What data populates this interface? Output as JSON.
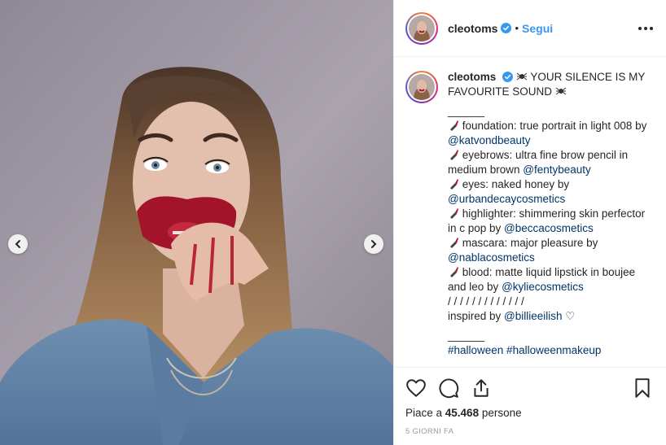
{
  "post": {
    "username": "cleotoms",
    "separator": "•",
    "follow_label": "Segui",
    "more_icon": "more-options-icon"
  },
  "caption": {
    "username": "cleotoms",
    "title": "YOUR SILENCE IS MY FAVOURITE SOUND",
    "divider1": "______",
    "items": [
      {
        "text": "foundation: true portrait in light 008 by ",
        "tag": "@katvondbeauty"
      },
      {
        "text": "eyebrows: ultra fine brow pencil in medium brown ",
        "tag": "@fentybeauty"
      },
      {
        "text": "eyes: naked honey by ",
        "tag": "@urbandecaycosmetics"
      },
      {
        "text": "highlighter: shimmering skin perfector in c pop by ",
        "tag": "@beccacosmetics"
      },
      {
        "text": "mascara: major pleasure by ",
        "tag": "@nablacosmetics"
      },
      {
        "text": "blood: matte liquid lipstick in boujee and leo by ",
        "tag": "@kyliecosmetics"
      }
    ],
    "slashes": "/ / / / / / / / / / / / /",
    "inspired_text": "inspired by ",
    "inspired_tag": "@billieeilish",
    "heart": "♡",
    "divider2": "______",
    "hashtags": "#halloween #halloweenmakeup"
  },
  "actions": {
    "likes_prefix": "Piace a ",
    "likes_count": "45.468",
    "likes_suffix": " persone",
    "time": "5 GIORNI FA"
  },
  "colors": {
    "link": "#003569",
    "follow": "#3897f0",
    "verified": "#3897f0"
  }
}
